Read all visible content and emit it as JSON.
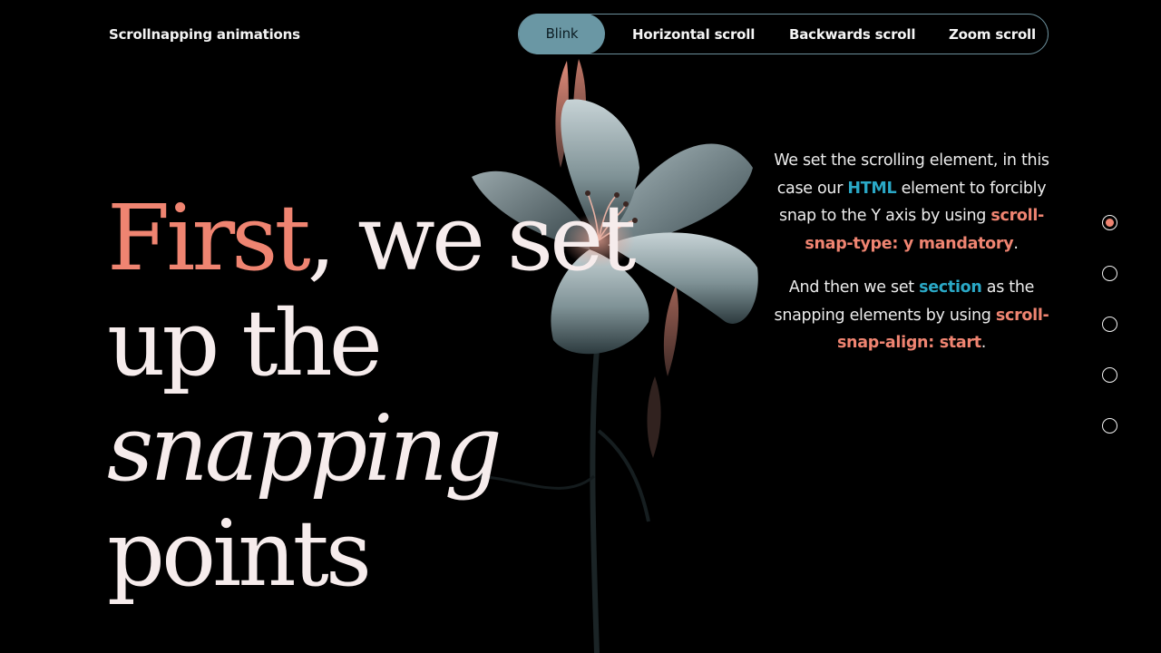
{
  "header": {
    "brand": "Scrollnapping animations",
    "nav": [
      {
        "label": "Blink",
        "active": true
      },
      {
        "label": "Horizontal scroll",
        "active": false
      },
      {
        "label": "Backwards scroll",
        "active": false
      },
      {
        "label": "Zoom scroll",
        "active": false
      }
    ]
  },
  "hero": {
    "accent_word": "First",
    "line1_rest": ", we set",
    "line2": "up the",
    "line3": "snapping",
    "line4": "points"
  },
  "explain": {
    "p1_a": "We set the scrolling element, in this case our ",
    "p1_kw1": "HTML",
    "p1_b": " element to forcibly snap to the Y axis by using ",
    "p1_kw2": "scroll-snap-type: y mandatory",
    "p1_c": ".",
    "p2_a": "And then we set ",
    "p2_kw1": "section",
    "p2_b": " as the snapping elements by using ",
    "p2_kw2": "scroll-snap-align: start",
    "p2_c": "."
  },
  "pagination": {
    "count": 5,
    "active_index": 0
  },
  "colors": {
    "accent": "#ef8471",
    "keyword_blue": "#2aa8c6",
    "nav_active": "#6a97a4",
    "background": "#000000"
  },
  "image": {
    "name": "lily-flower-image"
  }
}
